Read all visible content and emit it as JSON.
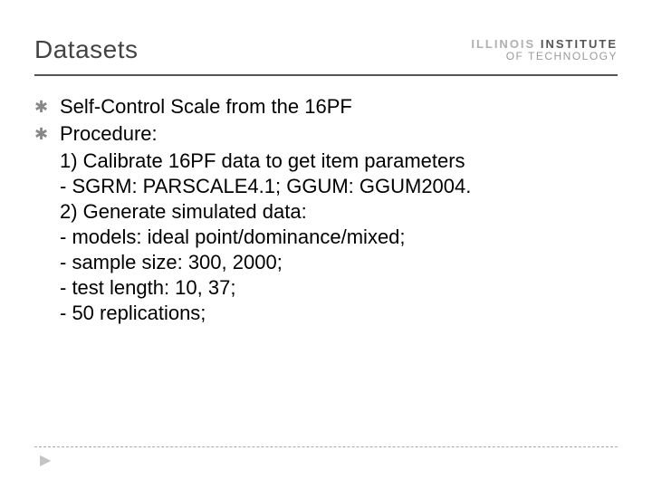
{
  "header": {
    "title": "Datasets",
    "logo_line1_a": "ILLINOIS ",
    "logo_line1_b": "INSTITUTE",
    "logo_line2": "OF TECHNOLOGY"
  },
  "bullets": {
    "marker": "✱",
    "item1": "Self-Control Scale from the 16PF",
    "item2": "Procedure:",
    "item2_lines": {
      "l0": "1) Calibrate 16PF data to get item parameters",
      "l1": " - SGRM: PARSCALE4.1; GGUM: GGUM2004.",
      "l2": "2) Generate simulated data:",
      "l3": " - models: ideal point/dominance/mixed;",
      "l4": " - sample size: 300, 2000;",
      "l5": " - test length: 10, 37;",
      "l6": " - 50 replications;"
    }
  },
  "footer": {
    "arrow": "▶"
  }
}
